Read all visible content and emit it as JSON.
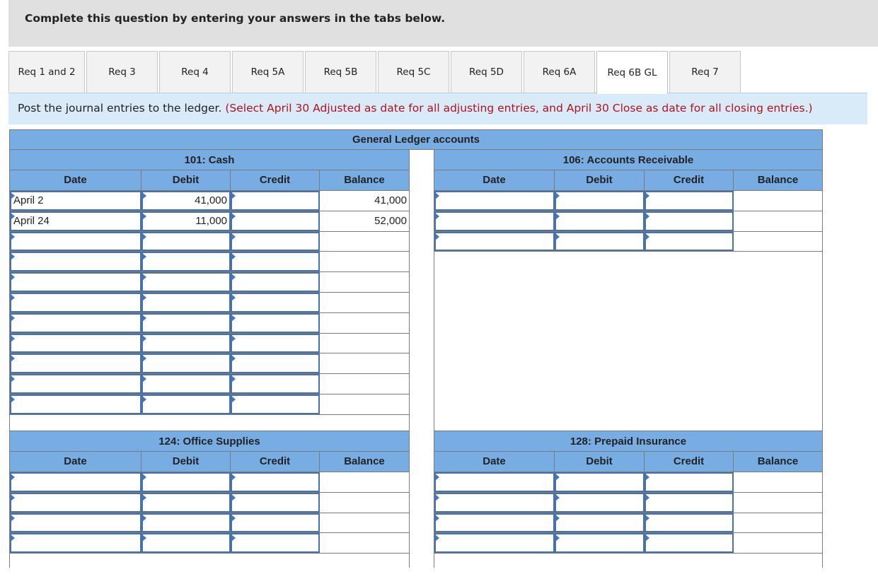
{
  "banner": {
    "text": "Complete this question by entering your answers in the tabs below."
  },
  "tabs": [
    {
      "label": "Req 1 and 2",
      "active": false
    },
    {
      "label": "Req 3",
      "active": false
    },
    {
      "label": "Req 4",
      "active": false
    },
    {
      "label": "Req 5A",
      "active": false
    },
    {
      "label": "Req 5B",
      "active": false
    },
    {
      "label": "Req 5C",
      "active": false
    },
    {
      "label": "Req 5D",
      "active": false
    },
    {
      "label": "Req 6A",
      "active": false
    },
    {
      "label": "Req 6B GL",
      "active": true
    },
    {
      "label": "Req 7",
      "active": false
    }
  ],
  "instructions": {
    "main": "Post the journal entries to the ledger.",
    "note": "(Select April 30 Adjusted as date for all adjusting entries, and April 30 Close as date for all closing entries.)"
  },
  "ledger": {
    "title": "General Ledger accounts",
    "columns": {
      "date": "Date",
      "debit": "Debit",
      "credit": "Credit",
      "balance": "Balance"
    },
    "accounts": {
      "cash": {
        "name": "101: Cash",
        "rows": [
          {
            "date": "April 2",
            "debit": "41,000",
            "credit": "",
            "balance": "41,000"
          },
          {
            "date": "April 24",
            "debit": "11,000",
            "credit": "",
            "balance": "52,000"
          },
          {
            "date": "",
            "debit": "",
            "credit": "",
            "balance": ""
          },
          {
            "date": "",
            "debit": "",
            "credit": "",
            "balance": ""
          },
          {
            "date": "",
            "debit": "",
            "credit": "",
            "balance": ""
          },
          {
            "date": "",
            "debit": "",
            "credit": "",
            "balance": ""
          },
          {
            "date": "",
            "debit": "",
            "credit": "",
            "balance": ""
          },
          {
            "date": "",
            "debit": "",
            "credit": "",
            "balance": ""
          },
          {
            "date": "",
            "debit": "",
            "credit": "",
            "balance": ""
          },
          {
            "date": "",
            "debit": "",
            "credit": "",
            "balance": ""
          },
          {
            "date": "",
            "debit": "",
            "credit": "",
            "balance": ""
          }
        ]
      },
      "accounts_receivable": {
        "name": "106: Accounts Receivable",
        "rows": [
          {
            "date": "",
            "debit": "",
            "credit": "",
            "balance": ""
          },
          {
            "date": "",
            "debit": "",
            "credit": "",
            "balance": ""
          },
          {
            "date": "",
            "debit": "",
            "credit": "",
            "balance": ""
          }
        ]
      },
      "office_supplies": {
        "name": "124: Office Supplies",
        "rows": [
          {
            "date": "",
            "debit": "",
            "credit": "",
            "balance": ""
          },
          {
            "date": "",
            "debit": "",
            "credit": "",
            "balance": ""
          },
          {
            "date": "",
            "debit": "",
            "credit": "",
            "balance": ""
          },
          {
            "date": "",
            "debit": "",
            "credit": "",
            "balance": ""
          }
        ]
      },
      "prepaid_insurance": {
        "name": "128: Prepaid Insurance",
        "rows": [
          {
            "date": "",
            "debit": "",
            "credit": "",
            "balance": ""
          },
          {
            "date": "",
            "debit": "",
            "credit": "",
            "balance": ""
          },
          {
            "date": "",
            "debit": "",
            "credit": "",
            "balance": ""
          },
          {
            "date": "",
            "debit": "",
            "credit": "",
            "balance": ""
          }
        ]
      }
    }
  }
}
